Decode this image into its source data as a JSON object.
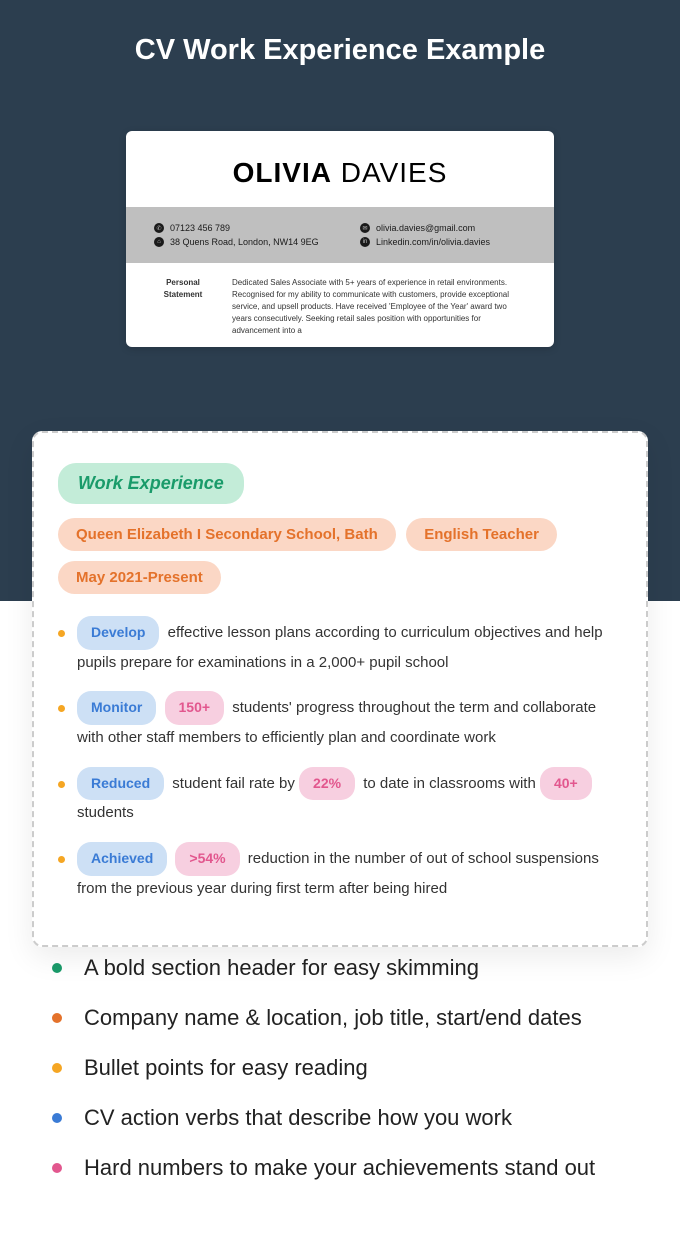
{
  "page_title": "CV Work Experience Example",
  "resume": {
    "first_name": "OLIVIA",
    "last_name": "DAVIES",
    "contacts": {
      "phone": "07123 456 789",
      "address": "38 Quens Road, London, NW14 9EG",
      "email": "olivia.davies@gmail.com",
      "linkedin": "Linkedin.com/in/olivia.davies"
    },
    "statement_label": "Personal Statement",
    "statement_text": "Dedicated Sales Associate with 5+ years of experience in retail environments. Recognised for my ability to communicate with customers, provide exceptional service, and upsell products. Have received 'Employee of the Year' award two years consecutively. Seeking retail sales position with opportunities for advancement into a"
  },
  "overlay": {
    "section_header": "Work Experience",
    "company": "Queen Elizabeth I Secondary School, Bath",
    "job_title": "English Teacher",
    "dates": "May 2021-Present",
    "bullets": [
      {
        "verb": "Develop",
        "extra_pink": null,
        "rest": " effective lesson plans according to curriculum objectives and help pupils prepare for examinations in a 2,000+ pupil school"
      },
      {
        "verb": "Monitor",
        "extra_pink": "150+",
        "rest": " students' progress throughout the term and collaborate with other staff members to efficiently plan and coordinate work"
      },
      {
        "verb": "Reduced",
        "extra_pink": null,
        "mid": " student fail rate by ",
        "num1": "22%",
        "mid2": " to date in classrooms with ",
        "num2": "40+",
        "tail": " students"
      },
      {
        "verb": "Achieved",
        "extra_pink": ">54%",
        "rest": " reduction in the number of out of school suspensions from the previous year during first term after being hired"
      }
    ]
  },
  "legend": [
    "A bold section header for easy skimming",
    "Company name & location, job title, start/end dates",
    "Bullet points for easy reading",
    "CV action verbs that describe how you work",
    "Hard numbers to make your achievements stand out"
  ]
}
